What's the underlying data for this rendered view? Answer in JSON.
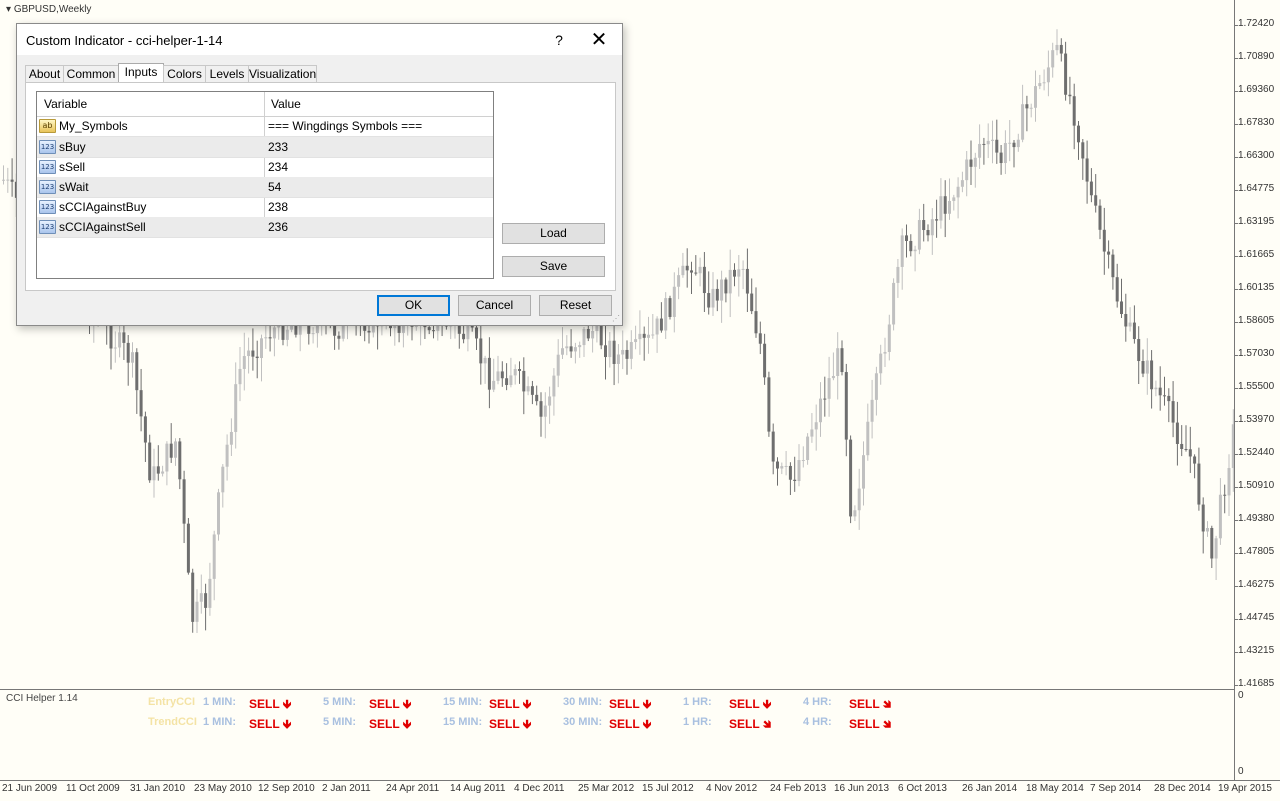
{
  "chart": {
    "title": "GBPUSD,Weekly",
    "price_labels": [
      "1.72420",
      "1.70890",
      "1.69360",
      "1.67830",
      "1.66300",
      "1.64775",
      "1.63195",
      "1.61665",
      "1.60135",
      "1.58605",
      "1.57030",
      "1.55500",
      "1.53970",
      "1.52440",
      "1.50910",
      "1.49380",
      "1.47805",
      "1.46275",
      "1.44745",
      "1.43215",
      "1.41685"
    ],
    "time_labels": [
      "21 Jun 2009",
      "11 Oct 2009",
      "31 Jan 2010",
      "23 May 2010",
      "12 Sep 2010",
      "2 Jan 2011",
      "24 Apr 2011",
      "14 Aug 2011",
      "4 Dec 2011",
      "25 Mar 2012",
      "15 Jul 2012",
      "4 Nov 2012",
      "24 Feb 2013",
      "16 Jun 2013",
      "6 Oct 2013",
      "26 Jan 2014",
      "18 May 2014",
      "7 Sep 2014",
      "28 Dec 2014",
      "19 Apr 2015"
    ]
  },
  "subwindow": {
    "title": "CCI Helper 1.14",
    "axis_top": "0",
    "axis_bottom": "0",
    "rows": [
      {
        "label": "EntryCCI",
        "cells": [
          {
            "tf": "1 MIN:",
            "signal": "SELL",
            "arrow": "🡻"
          },
          {
            "tf": "5 MIN:",
            "signal": "SELL",
            "arrow": "🡻"
          },
          {
            "tf": "15 MIN:",
            "signal": "SELL",
            "arrow": "🡻"
          },
          {
            "tf": "30 MIN:",
            "signal": "SELL",
            "arrow": "🡻"
          },
          {
            "tf": "1 HR:",
            "signal": "SELL",
            "arrow": "🡻"
          },
          {
            "tf": "4 HR:",
            "signal": "SELL",
            "arrow": "🡾"
          }
        ]
      },
      {
        "label": "TrendCCI",
        "cells": [
          {
            "tf": "1 MIN:",
            "signal": "SELL",
            "arrow": "🡻"
          },
          {
            "tf": "5 MIN:",
            "signal": "SELL",
            "arrow": "🡻"
          },
          {
            "tf": "15 MIN:",
            "signal": "SELL",
            "arrow": "🡻"
          },
          {
            "tf": "30 MIN:",
            "signal": "SELL",
            "arrow": "🡻"
          },
          {
            "tf": "1 HR:",
            "signal": "SELL",
            "arrow": "🡾"
          },
          {
            "tf": "4 HR:",
            "signal": "SELL",
            "arrow": "🡾"
          }
        ]
      }
    ]
  },
  "dialog": {
    "title": "Custom Indicator - cci-helper-1-14",
    "help": "?",
    "close": "✕",
    "tabs": [
      "About",
      "Common",
      "Inputs",
      "Colors",
      "Levels",
      "Visualization"
    ],
    "active_tab": "Inputs",
    "grid": {
      "headers": [
        "Variable",
        "Value"
      ],
      "rows": [
        {
          "icon": "ab",
          "variable": "My_Symbols",
          "value": "=== Wingdings Symbols ==="
        },
        {
          "icon": "123",
          "variable": "sBuy",
          "value": "233"
        },
        {
          "icon": "123",
          "variable": "sSell",
          "value": "234"
        },
        {
          "icon": "123",
          "variable": "sWait",
          "value": "54"
        },
        {
          "icon": "123",
          "variable": "sCCIAgainstBuy",
          "value": "238"
        },
        {
          "icon": "123",
          "variable": "sCCIAgainstSell",
          "value": "236"
        }
      ]
    },
    "load_label": "Load",
    "save_label": "Save",
    "ok_label": "OK",
    "cancel_label": "Cancel",
    "reset_label": "Reset"
  },
  "colors": {
    "bull_candle": "#c0c0c0",
    "bear_candle": "#6e6e6e",
    "sell": "#e00000",
    "timeframe": "#a9c0e0",
    "row_label": "#f4e3a5"
  }
}
